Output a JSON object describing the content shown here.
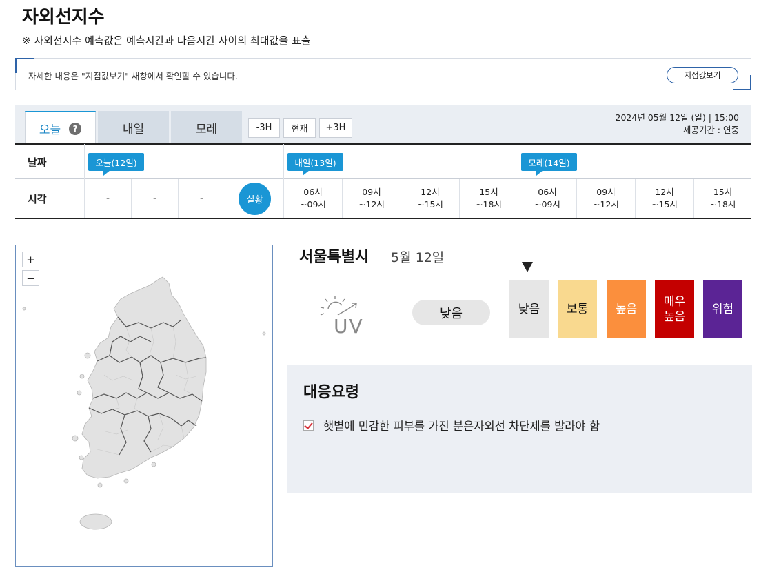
{
  "page": {
    "title": "자외선지수",
    "notice": "※ 자외선지수 예측값은 예측시간과 다음시간 사이의 최대값을 표출"
  },
  "info": {
    "text": "자세한 내용은 \"지점값보기\" 새창에서 확인할 수 있습니다.",
    "station_button": "지점값보기"
  },
  "tabs": {
    "today": "오늘",
    "help": "?",
    "tomorrow": "내일",
    "after_tomorrow": "모레"
  },
  "shift": {
    "minus": "-3H",
    "now": "현재",
    "plus": "+3H"
  },
  "timestamp": {
    "datetime": "2024년 05월 12일 (일) | 15:00",
    "provider": "제공기간 : 연중"
  },
  "table": {
    "date_label": "날짜",
    "time_label": "시각",
    "day_flags": [
      "오늘(12일)",
      "내일(13일)",
      "모레(14일)"
    ],
    "past_slots": [
      "-",
      "-",
      "-"
    ],
    "now_label": "실황",
    "slots": [
      {
        "start": "06시",
        "end": "~09시"
      },
      {
        "start": "09시",
        "end": "~12시"
      },
      {
        "start": "12시",
        "end": "~15시"
      },
      {
        "start": "15시",
        "end": "~18시"
      },
      {
        "start": "06시",
        "end": "~09시"
      },
      {
        "start": "09시",
        "end": "~12시"
      },
      {
        "start": "12시",
        "end": "~15시"
      },
      {
        "start": "15시",
        "end": "~18시"
      }
    ]
  },
  "map": {
    "zoom_in": "+",
    "zoom_out": "−"
  },
  "detail": {
    "city": "서울특별시",
    "date": "5월 12일",
    "current_level": "낮음",
    "uv_icon_text": "UV",
    "scale": [
      {
        "label": "낮음",
        "color": "#e6e6e6",
        "text_color": "#111111"
      },
      {
        "label": "보통",
        "color": "#f9d98f",
        "text_color": "#111111"
      },
      {
        "label": "높음",
        "color": "#fb8f3d",
        "text_color": "#ffffff"
      },
      {
        "label": "매우\n높음",
        "color": "#c40000",
        "text_color": "#ffffff"
      },
      {
        "label": "위험",
        "color": "#5b2495",
        "text_color": "#ffffff"
      }
    ]
  },
  "response": {
    "title": "대응요령",
    "items": [
      "햇볕에 민감한 피부를 가진 분은자외선 차단제를 발라야 함"
    ]
  }
}
